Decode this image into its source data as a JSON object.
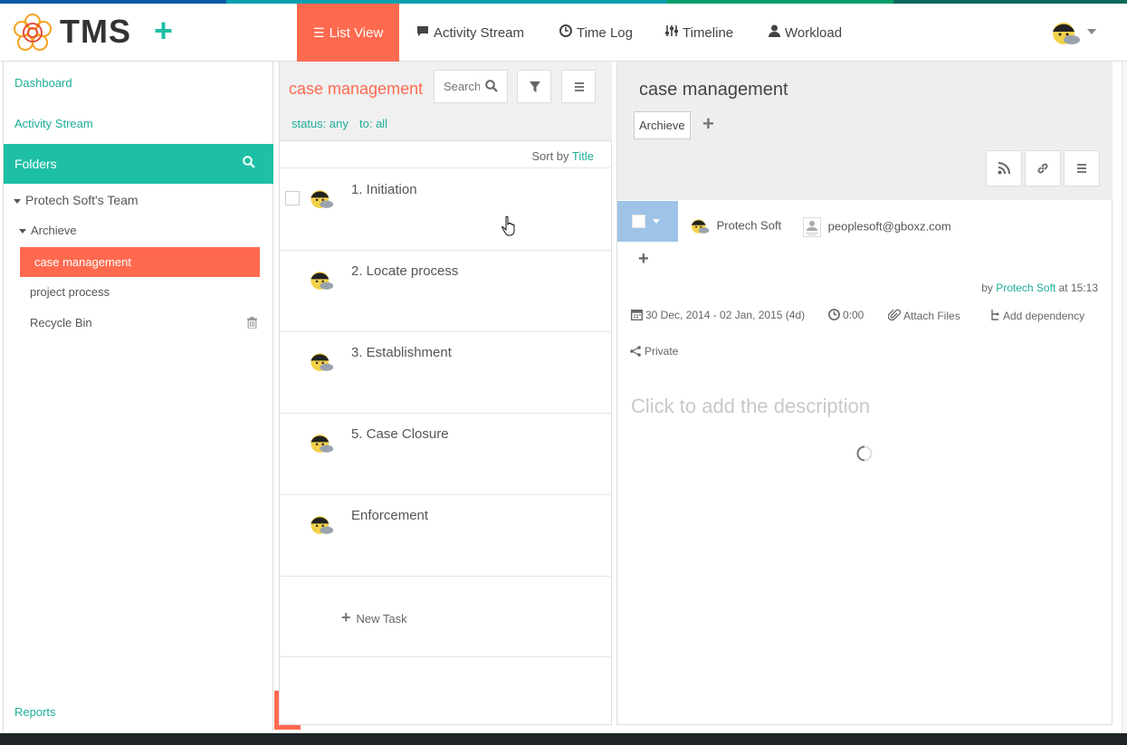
{
  "app": {
    "logo_text": "TMS",
    "add_label": "+",
    "accent_colors": {
      "teal": "#1dbfa6",
      "coral": "#ff6a4f",
      "status_blue": "#9ec3e6"
    },
    "top_strip_colors": [
      "#0e5aa7",
      "#0aa0b0",
      "#0a9f6c",
      "#0a6a5c"
    ]
  },
  "nav": {
    "tabs": [
      {
        "label": "List View",
        "icon": "list-icon",
        "active": true
      },
      {
        "label": "Activity Stream",
        "icon": "comment-icon",
        "active": false
      },
      {
        "label": "Time Log",
        "icon": "clock-icon",
        "active": false
      },
      {
        "label": "Timeline",
        "icon": "sliders-icon",
        "active": false
      },
      {
        "label": "Workload",
        "icon": "user-icon",
        "active": false
      }
    ]
  },
  "sidebar": {
    "dashboard": "Dashboard",
    "activity_stream": "Activity Stream",
    "folders": "Folders",
    "team": "Protech Soft's Team",
    "archieve": "Archieve",
    "active_folder": "case management",
    "project_process": "project process",
    "recycle_bin": "Recycle Bin",
    "reports": "Reports"
  },
  "list": {
    "title": "case management",
    "search_placeholder": "Search",
    "filter_status": "status: any",
    "filter_to": "to: all",
    "sort_prefix": "Sort by",
    "sort_field": "Title",
    "tasks": [
      {
        "title": "1. Initiation"
      },
      {
        "title": "2. Locate process"
      },
      {
        "title": "3. Establishment"
      },
      {
        "title": "5. Case Closure"
      },
      {
        "title": "Enforcement"
      }
    ],
    "new_task": "New Task"
  },
  "detail": {
    "title": "case management",
    "tag": "Archieve",
    "assignee_1": "Protech Soft",
    "assignee_2": "peoplesoft@gboxz.com",
    "by_prefix": "by",
    "by_user": "Protech Soft",
    "by_time": "at 15:13",
    "dates": "30 Dec, 2014 - 02 Jan, 2015 (4d)",
    "time": "0:00",
    "attach": "Attach Files",
    "dependency": "Add dependency",
    "privacy": "Private",
    "description_placeholder": "Click to add the description"
  }
}
